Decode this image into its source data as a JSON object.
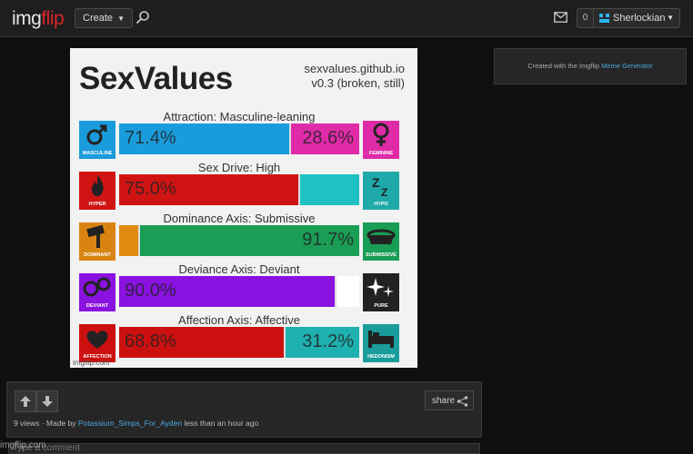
{
  "header": {
    "logo_part1": "img",
    "logo_part2": "flip",
    "create_label": "Create",
    "notifications_count": "0",
    "username": "Sherlockian"
  },
  "meme": {
    "title": "SexValues",
    "site_line1": "sexvalues.github.io",
    "site_line2": "v0.3 (broken, still)",
    "watermark": "imgflip.com",
    "axes": [
      {
        "label": "Attraction: Masculine-leaning",
        "left_icon": "male-symbol-icon",
        "left_caption": "MASCULINE",
        "right_icon": "female-symbol-icon",
        "right_caption": "FEMININE",
        "left_value": "71.4%",
        "right_value": "28.6%",
        "left_fraction": 0.714,
        "left_color": "#1a9cdc",
        "right_color": "#e02ba8",
        "left_icon_bg": "#1a9cdc",
        "right_icon_bg": "#e02ba8"
      },
      {
        "label": "Sex Drive: High",
        "left_icon": "fire-icon",
        "left_caption": "HYPER",
        "right_icon": "sleep-icon",
        "right_caption": "HYPO",
        "left_value": "75.0%",
        "right_value": "",
        "left_fraction": 0.75,
        "left_color": "#d01414",
        "right_color": "#1fc2c2",
        "left_icon_bg": "#d01414",
        "right_icon_bg": "#1fa9a9"
      },
      {
        "label": "Dominance Axis: Submissive",
        "left_icon": "gavel-icon",
        "left_caption": "DOMINANT",
        "right_icon": "dog-bowl-icon",
        "right_caption": "SUBMISSIVE",
        "left_value": "",
        "right_value": "91.7%",
        "left_fraction": 0.083,
        "left_color": "#e08a10",
        "right_color": "#1a9d55",
        "left_icon_bg": "#d98412",
        "right_icon_bg": "#1a9d55"
      },
      {
        "label": "Deviance Axis: Deviant",
        "left_icon": "handcuffs-icon",
        "left_caption": "DEVIANT",
        "right_icon": "sparkles-icon",
        "right_caption": "PURE",
        "left_value": "90.0%",
        "right_value": "",
        "left_fraction": 0.9,
        "left_color": "#8a12e0",
        "right_color": "#ffffff",
        "left_icon_bg": "#8a12e0",
        "right_icon_bg": "#222222"
      },
      {
        "label": "Affection Axis: Affective",
        "left_icon": "hearts-icon",
        "left_caption": "AFFECTION",
        "right_icon": "bed-icon",
        "right_caption": "HEDONISM",
        "left_value": "68.8%",
        "right_value": "31.2%",
        "left_fraction": 0.688,
        "left_color": "#cc1010",
        "right_color": "#1fb0b0",
        "left_icon_bg": "#cc1010",
        "right_icon_bg": "#1a9c9c"
      }
    ]
  },
  "sidebar": {
    "created_prefix": "Created with the Imgflip",
    "created_link": "Meme Generator"
  },
  "post": {
    "share_label": "share",
    "views": "9 views",
    "made_by": "· Made by",
    "author": "Potassium_Simps_For_Ayden",
    "time": "less than an hour ago"
  },
  "comments": {
    "watermark": "imgflip.com",
    "placeholder": "Type a comment"
  }
}
